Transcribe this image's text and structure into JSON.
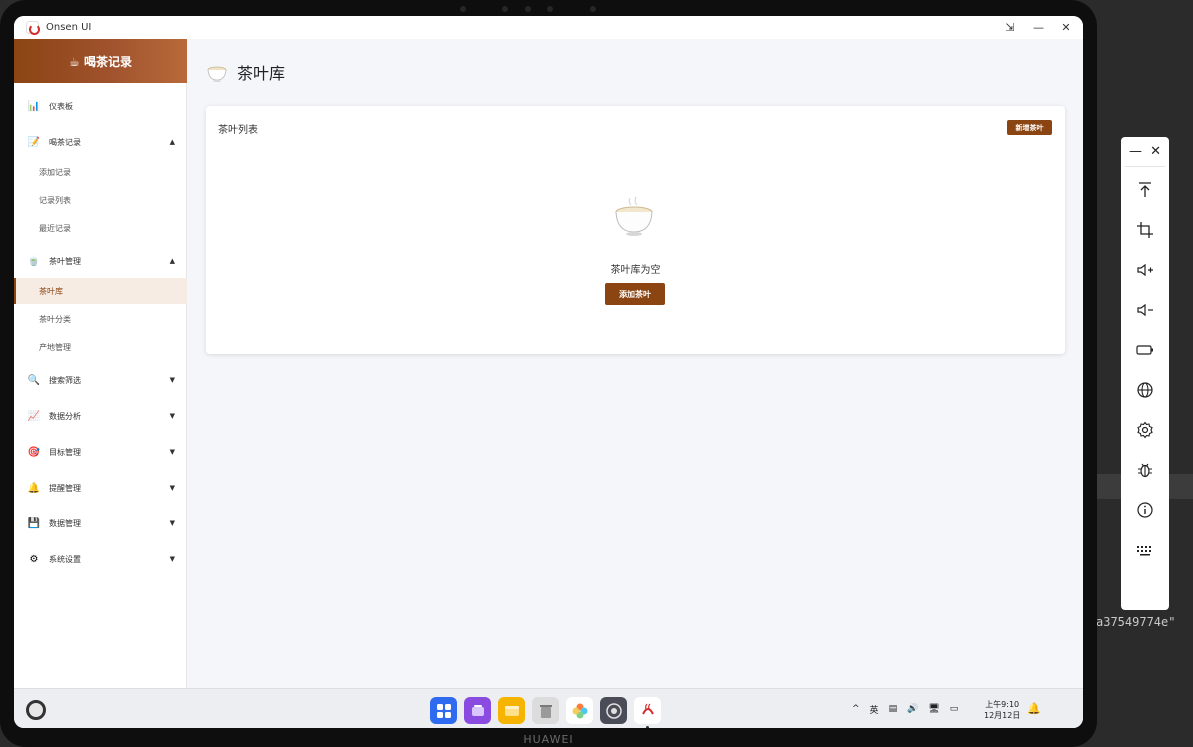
{
  "window": {
    "title": "Onsen UI",
    "controls": [
      "⇲",
      "—",
      "✕"
    ]
  },
  "sidebar": {
    "header": "☕ 喝茶记录",
    "groups": [
      {
        "icon": "📊",
        "label": "仪表板"
      },
      {
        "icon": "📝",
        "label": "喝茶记录",
        "arrow": "▲",
        "subs": [
          "添加记录",
          "记录列表",
          "最近记录"
        ]
      },
      {
        "icon": "🍵",
        "label": "茶叶管理",
        "arrow": "▲",
        "subs": [
          "茶叶库",
          "茶叶分类",
          "产地管理"
        ]
      },
      {
        "icon": "🔍",
        "label": "搜索筛选",
        "arrow": "▼"
      },
      {
        "icon": "📈",
        "label": "数据分析",
        "arrow": "▼"
      },
      {
        "icon": "🎯",
        "label": "目标管理",
        "arrow": "▼"
      },
      {
        "icon": "🔔",
        "label": "提醒管理",
        "arrow": "▼"
      },
      {
        "icon": "💾",
        "label": "数据管理",
        "arrow": "▼"
      },
      {
        "icon": "⚙",
        "label": "系统设置",
        "arrow": "▼"
      }
    ]
  },
  "main": {
    "title": "茶叶库",
    "card": {
      "title": "茶叶列表",
      "new_button": "新增茶叶",
      "empty_text": "茶叶库为空",
      "add_button": "添加茶叶"
    }
  },
  "taskbar": {
    "tray": {
      "ime": "英",
      "clock_line1": "上午9:10",
      "clock_line2": "12月12日"
    }
  },
  "device": {
    "brand": "HUAWEI"
  },
  "background": {
    "code_text": "a37549774e\""
  },
  "colors": {
    "accent": "#8b4513",
    "active_bg": "#f6ece4"
  }
}
